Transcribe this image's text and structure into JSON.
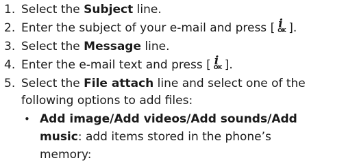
{
  "steps": [
    {
      "num": "1.",
      "pre": "Select the ",
      "bold": "Subject",
      "post": " line."
    },
    {
      "num": "2.",
      "pre": "Enter the subject of your e-mail and press [",
      "post": "]."
    },
    {
      "num": "3.",
      "pre": "Select the ",
      "bold": "Message",
      "post": " line."
    },
    {
      "num": "4.",
      "pre": "Enter the e-mail text and press [",
      "post": "]."
    },
    {
      "num": "5.",
      "pre": "Select the ",
      "bold": "File attach",
      "post": " line and select one of the",
      "cont": "following options to add files:"
    }
  ],
  "ok_key": {
    "glyph": "i",
    "label": "OK"
  },
  "bullet": {
    "mark": "•",
    "bold_1": "Add image",
    "sep_1": "/",
    "bold_2": "Add videos",
    "sep_2": "/",
    "bold_3": "Add sounds",
    "sep_3": "/",
    "bold_4": "Add",
    "bold_5": "music",
    "text_1": ": add items stored in the phone’s",
    "text_2": "memory:"
  }
}
